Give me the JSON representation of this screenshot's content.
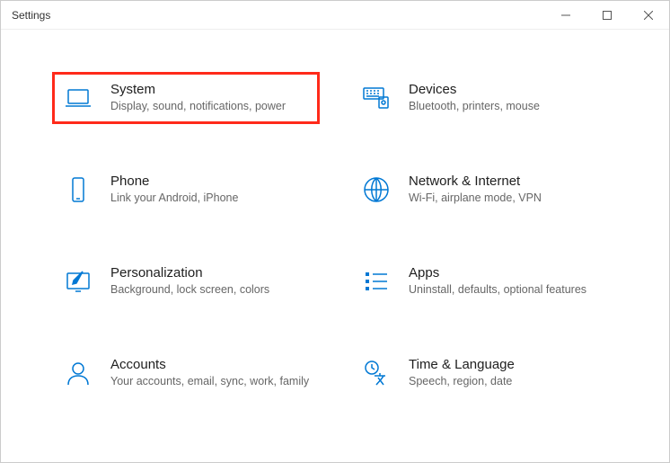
{
  "window": {
    "title": "Settings"
  },
  "tiles": [
    {
      "id": "system",
      "title": "System",
      "desc": "Display, sound, notifications, power",
      "highlighted": true
    },
    {
      "id": "devices",
      "title": "Devices",
      "desc": "Bluetooth, printers, mouse",
      "highlighted": false
    },
    {
      "id": "phone",
      "title": "Phone",
      "desc": "Link your Android, iPhone",
      "highlighted": false
    },
    {
      "id": "network",
      "title": "Network & Internet",
      "desc": "Wi-Fi, airplane mode, VPN",
      "highlighted": false
    },
    {
      "id": "personalization",
      "title": "Personalization",
      "desc": "Background, lock screen, colors",
      "highlighted": false
    },
    {
      "id": "apps",
      "title": "Apps",
      "desc": "Uninstall, defaults, optional features",
      "highlighted": false
    },
    {
      "id": "accounts",
      "title": "Accounts",
      "desc": "Your accounts, email, sync, work, family",
      "highlighted": false
    },
    {
      "id": "timelang",
      "title": "Time & Language",
      "desc": "Speech, region, date",
      "highlighted": false
    }
  ],
  "colors": {
    "accent": "#0078d4",
    "highlight_border": "#ff2a1a"
  }
}
